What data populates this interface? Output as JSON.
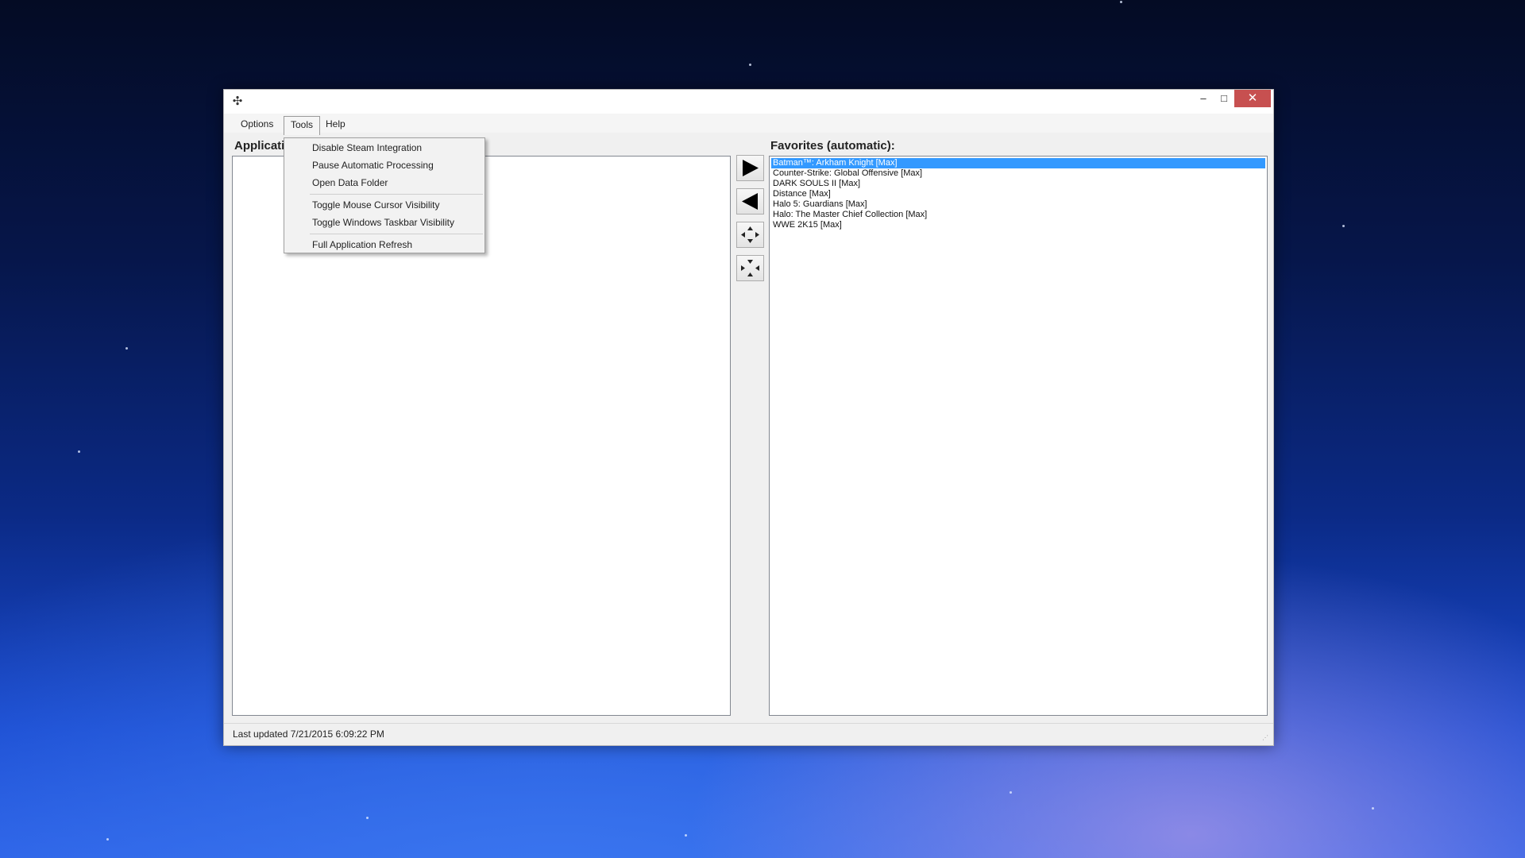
{
  "window": {
    "controls": {
      "minimize": "–",
      "maximize": "□",
      "close": "✕"
    }
  },
  "menubar": {
    "options": "Options",
    "tools": "Tools",
    "help": "Help"
  },
  "tools_menu": {
    "items": [
      "Disable Steam Integration",
      "Pause Automatic Processing",
      "Open Data Folder",
      "Toggle Mouse Cursor Visibility",
      "Toggle Windows Taskbar Visibility",
      "Full Application Refresh"
    ]
  },
  "left_panel": {
    "title": "Applicati"
  },
  "right_panel": {
    "title": "Favorites (automatic):",
    "items": [
      "Batman™: Arkham Knight [Max]",
      "Counter-Strike: Global Offensive [Max]",
      "DARK SOULS II [Max]",
      "Distance [Max]",
      "Halo 5: Guardians [Max]",
      "Halo: The Master Chief Collection [Max]",
      "WWE 2K15 [Max]"
    ],
    "selected_index": 0
  },
  "middle_buttons": {
    "icons": [
      "arrow-right-icon",
      "arrow-left-icon",
      "expand-vertical-icon",
      "collapse-vertical-icon"
    ]
  },
  "status": {
    "text": "Last updated 7/21/2015 6:09:22 PM"
  },
  "colors": {
    "selection": "#3399ff",
    "close_button": "#c75050"
  }
}
